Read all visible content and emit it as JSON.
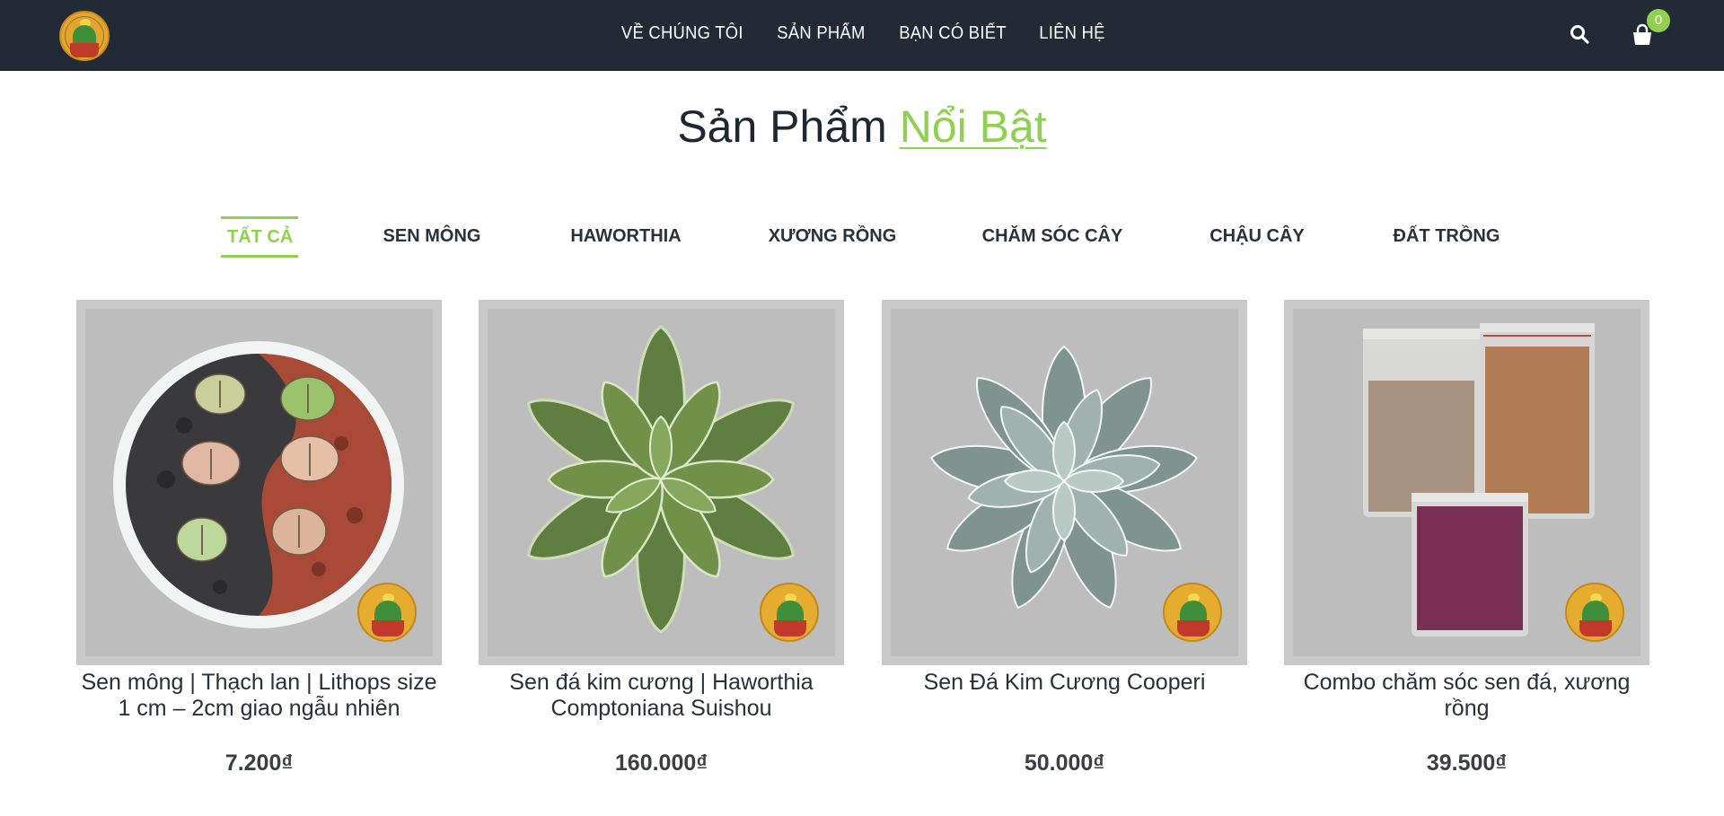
{
  "header": {
    "nav": [
      "VỀ CHÚNG TÔI",
      "SẢN PHẨM",
      "BẠN CÓ BIẾT",
      "LIÊN HỆ"
    ],
    "cart_count": "0",
    "icons": {
      "search": "search-icon",
      "cart": "shopping-bag-icon"
    }
  },
  "section": {
    "title_main": "Sản Phẩm",
    "title_accent": "Nổi Bật"
  },
  "tabs": [
    "TẤT CẢ",
    "SEN MÔNG",
    "HAWORTHIA",
    "XƯƠNG RỒNG",
    "CHĂM SÓC CÂY",
    "CHẬU CÂY",
    "ĐẤT TRỒNG"
  ],
  "active_tab": "TẤT CẢ",
  "products": [
    {
      "name": "Sen mông | Thạch lan | Lithops size 1 cm – 2cm giao ngẫu nhiên",
      "price": "7.200₫"
    },
    {
      "name": "Sen đá kim cương | Haworthia Comptoniana Suishou",
      "price": "160.000₫"
    },
    {
      "name": "Sen Đá Kim Cương Cooperi",
      "price": "50.000₫"
    },
    {
      "name": "Combo chăm sóc sen đá, xương rồng",
      "price": "39.500₫"
    }
  ],
  "colors": {
    "header_bg": "#222a35",
    "accent": "#8fd14f",
    "text": "#1f2733",
    "image_bg": "#bdbdbd"
  }
}
